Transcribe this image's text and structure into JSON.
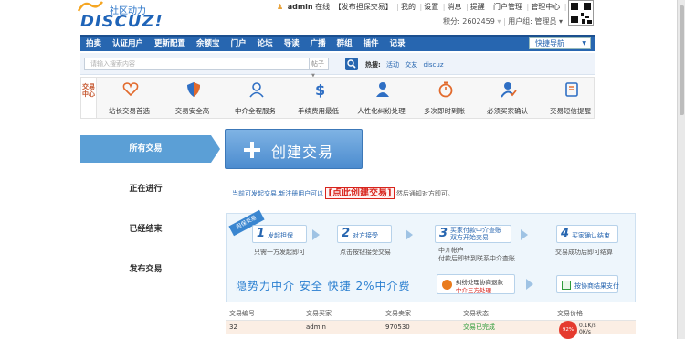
{
  "header": {
    "logo_cn": "社区动力",
    "logo_en": "DISCUZ!",
    "user": "admin",
    "online": "在线",
    "tag": "【发布担保交易】",
    "links": [
      "我的",
      "设置",
      "消息",
      "提醒",
      "门户管理",
      "管理中心",
      "退出"
    ],
    "credit": "积分: 2602459",
    "group": "用户组: 管理员"
  },
  "nav": {
    "items": [
      "拍卖",
      "认证用户",
      "更新配置",
      "余额宝",
      "门户",
      "论坛",
      "导读",
      "广播",
      "群组",
      "插件",
      "记录"
    ],
    "quick": "快捷导航"
  },
  "search": {
    "placeholder": "请输入搜索内容",
    "select": "帖子",
    "hot_label": "热搜:",
    "hot": [
      "活动",
      "交友",
      "discuz"
    ]
  },
  "features": {
    "tab": "交易中心",
    "items": [
      "站长交易首选",
      "交易安全高",
      "中介全程服务",
      "手续费用最低",
      "人性化纠纷处理",
      "多次即时到账",
      "必须买家确认",
      "交易短信提醒"
    ]
  },
  "sidebar": {
    "items": [
      "所有交易",
      "正在进行",
      "已经结束",
      "发布交易"
    ]
  },
  "main": {
    "create_label": "创建交易",
    "notice_a": "当前可发起交易,新注册用户可以",
    "notice_link": "[点此创建交易]",
    "notice_b": "然后通知对方即可。",
    "flow": {
      "ribbon": "担保交易",
      "s1_num": "1",
      "s1": "发起担保",
      "s1_sub": "只需一方发起即可",
      "s2_num": "2",
      "s2": "对方接受",
      "s2_sub": "点击按钮接受交易",
      "s3_num": "3",
      "s3_a": "买家付款中介查账",
      "s3_b": "双方开始交易",
      "s3_sub_a": "中介帐户",
      "s3_sub_b": "付款后即转到联系中介查账",
      "s4_num": "4",
      "s4": "买家确认结束",
      "s4_sub": "交易成功后即可结算",
      "slogan": "隐势力中介 安全 快捷 2%中介费",
      "dispute_a": "纠纷处理协商退款",
      "dispute_b": "中介三方处理",
      "payok": "按协商结果支付"
    },
    "table": {
      "headers": [
        "交易编号",
        "交易买家",
        "交易卖家",
        "交易状态",
        "交易价格"
      ],
      "rows": [
        [
          "32",
          "admin",
          "970530",
          "交易已完成",
          ""
        ]
      ],
      "gauge": "92%",
      "rate_a": "0.1K/s",
      "rate_b": "0K/s"
    }
  }
}
